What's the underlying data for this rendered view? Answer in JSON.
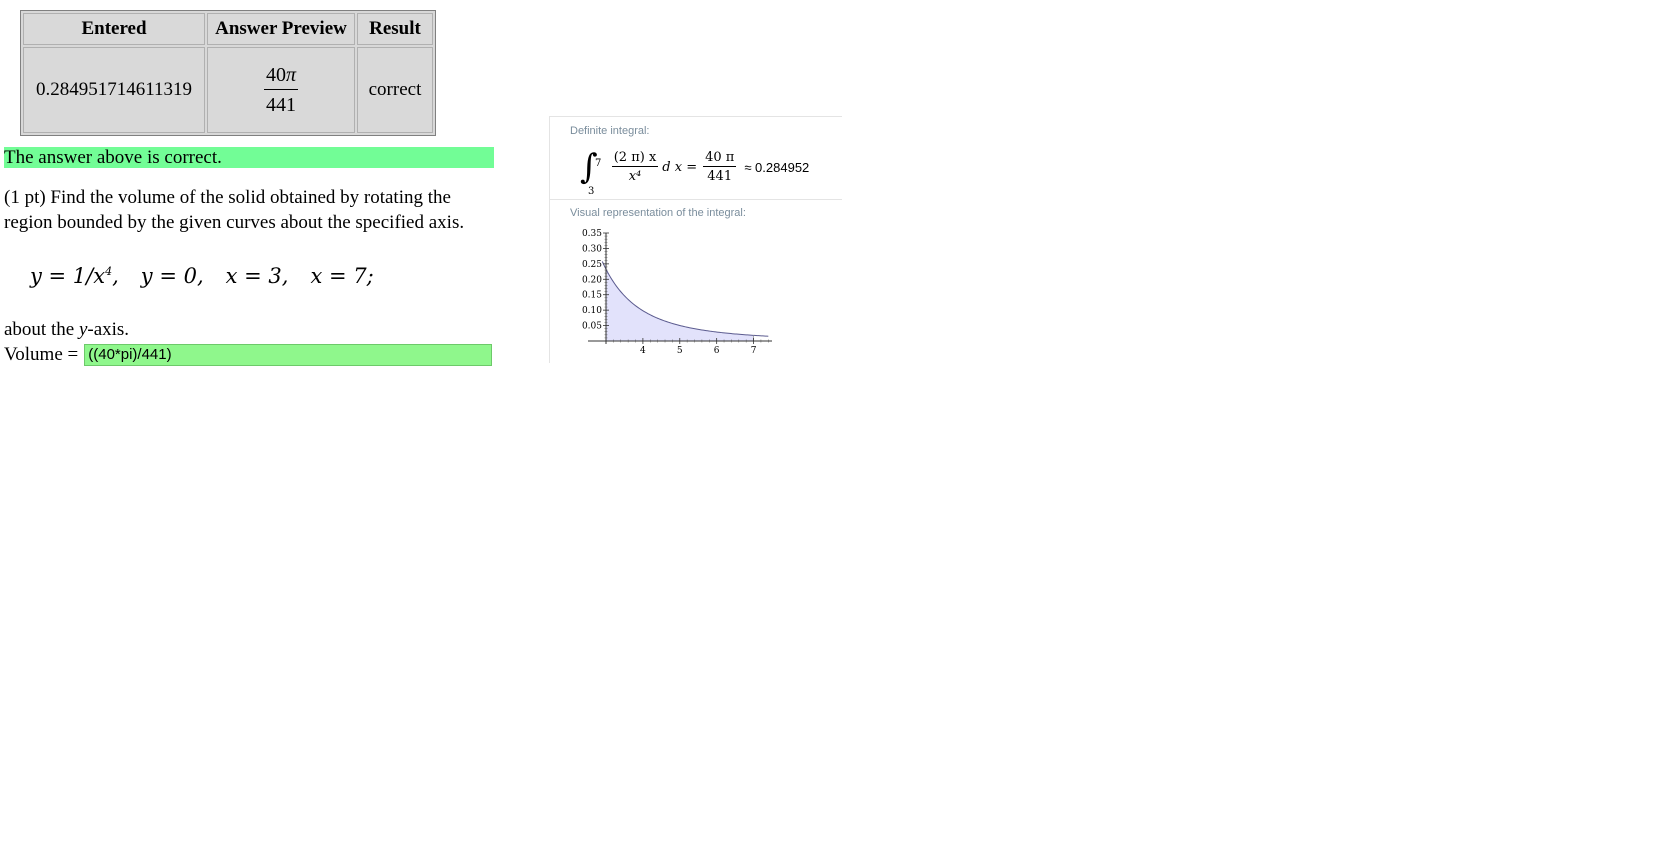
{
  "results_table": {
    "headers": [
      "Entered",
      "Answer Preview",
      "Result"
    ],
    "row": {
      "entered": "0.284951714611319",
      "preview_numerator": "40",
      "preview_pi": "π",
      "preview_denominator": "441",
      "result": "correct"
    }
  },
  "status_banner": "The answer above is correct.",
  "problem": {
    "text": "(1 pt) Find the volume of the solid obtained by rotating the region bounded by the given curves about the specified axis.",
    "equations": [
      "y = 1/x",
      "y = 0,",
      "x = 3,",
      "x = 7;"
    ],
    "exponent": "4",
    "about_prefix": "about the ",
    "about_var": "y",
    "about_suffix": "-axis.",
    "volume_label": "Volume =",
    "volume_value": "((40*pi)/441)"
  },
  "wolfram": {
    "definite_integral_title": "Definite integral:",
    "integrand_numerator": "(2 π) x",
    "integrand_denominator": "x⁴",
    "lower_limit": "3",
    "upper_limit": "7",
    "dx": "d x =",
    "result_numerator": "40 π",
    "result_denominator": "441",
    "approx": "≈ 0.284952",
    "visual_title": "Visual representation of the integral:",
    "colors": {
      "curve": "#5b5b8f",
      "fill": "#e2e2fb",
      "title": "#7a8d9c"
    }
  },
  "chart_data": {
    "type": "area",
    "function": "2*pi*x/x^4",
    "x": [
      3.0,
      3.25,
      3.5,
      3.75,
      4.0,
      4.5,
      5.0,
      5.5,
      6.0,
      6.5,
      7.0
    ],
    "y": [
      0.2327,
      0.183,
      0.1466,
      0.1191,
      0.0982,
      0.069,
      0.0503,
      0.0378,
      0.0291,
      0.0229,
      0.0183
    ],
    "x_ticks": [
      "4",
      "5",
      "6",
      "7"
    ],
    "y_ticks": [
      "0.05",
      "0.10",
      "0.15",
      "0.20",
      "0.25",
      "0.30",
      "0.35"
    ],
    "xlim": [
      3.0,
      7.5
    ],
    "ylim": [
      0,
      0.35
    ],
    "shaded_range": [
      3,
      7
    ]
  }
}
